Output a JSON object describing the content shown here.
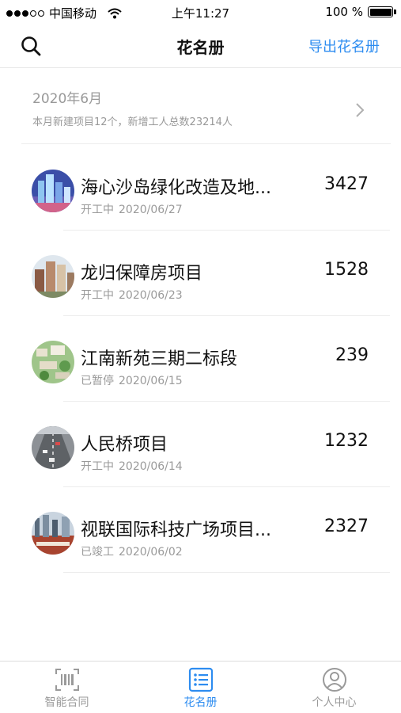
{
  "status_bar": {
    "carrier": "中国移动",
    "time": "上午11:27",
    "battery": "100 %"
  },
  "nav": {
    "title": "花名册",
    "action": "导出花名册",
    "search_icon": "search-icon"
  },
  "month": {
    "title": "2020年6月",
    "summary": "本月新建项目12个，新增工人总数23214人"
  },
  "projects": [
    {
      "name": "海心沙岛绿化改造及地...",
      "status": "开工中",
      "date": "2020/06/27",
      "count": "3427"
    },
    {
      "name": "龙归保障房项目",
      "status": "开工中",
      "date": "2020/06/23",
      "count": "1528"
    },
    {
      "name": "江南新苑三期二标段",
      "status": "已暂停",
      "date": "2020/06/15",
      "count": "239"
    },
    {
      "name": "人民桥项目",
      "status": "开工中",
      "date": "2020/06/14",
      "count": "1232"
    },
    {
      "name": "视联国际科技广场项目...",
      "status": "已竣工",
      "date": "2020/06/02",
      "count": "2327"
    }
  ],
  "tabs": [
    {
      "label": "智能合同",
      "icon": "scan-icon",
      "active": false
    },
    {
      "label": "花名册",
      "icon": "list-icon",
      "active": true
    },
    {
      "label": "个人中心",
      "icon": "user-icon",
      "active": false
    }
  ],
  "colors": {
    "accent": "#2d8cf0",
    "muted_text": "#999999"
  }
}
